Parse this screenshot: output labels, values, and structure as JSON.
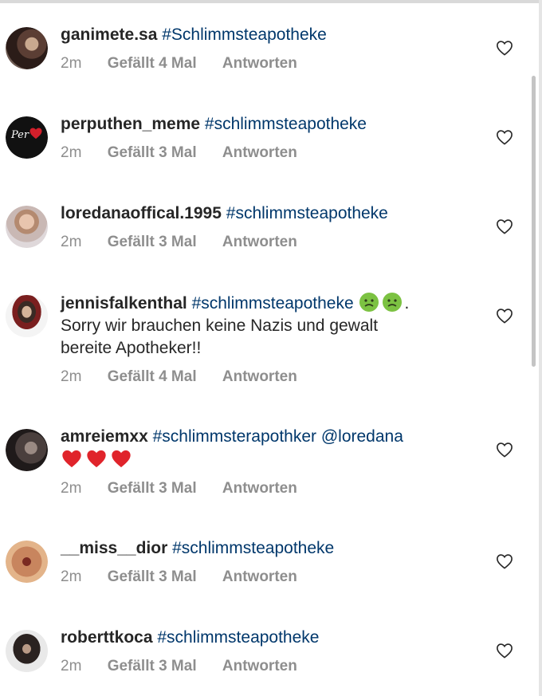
{
  "comments": [
    {
      "username": "ganimete.sa",
      "text": "#Schlimmsteapotheke",
      "time": "2m",
      "likes": "Gefällt 4 Mal",
      "reply": "Antworten"
    },
    {
      "username": "perputhen_meme",
      "text": "#schlimmsteapotheke",
      "time": "2m",
      "likes": "Gefällt 3 Mal",
      "reply": "Antworten",
      "avatar_text": "Per"
    },
    {
      "username": "loredanaoffical.1995",
      "text": "#schlimmsteapotheke",
      "time": "2m",
      "likes": "Gefällt 3 Mal",
      "reply": "Antworten"
    },
    {
      "username": "jennisfalkenthal",
      "text": "#schlimmsteapotheke",
      "text_after": ".",
      "text_line2": "Sorry wir brauchen keine Nazis und gewalt",
      "text_line3": "bereite Apotheker!!",
      "time": "2m",
      "likes": "Gefällt 4 Mal",
      "reply": "Antworten"
    },
    {
      "username": "amreiemxx",
      "text": "#schlimmsterapothker",
      "mention": "@loredana",
      "time": "2m",
      "likes": "Gefällt 3 Mal",
      "reply": "Antworten"
    },
    {
      "username": "__miss__dior",
      "text": "#schlimmsteapotheke",
      "time": "2m",
      "likes": "Gefällt 3 Mal",
      "reply": "Antworten"
    },
    {
      "username": "roberttkoca",
      "text": "#schlimmsteapotheke",
      "time": "2m",
      "likes": "Gefällt 3 Mal",
      "reply": "Antworten"
    }
  ],
  "icons": {
    "like": "heart-outline-icon",
    "emoji_sick": "nauseated-face-emoji",
    "emoji_heart": "red-heart-emoji"
  },
  "colors": {
    "hashtag": "#00376b",
    "meta": "#8e8e8e",
    "text": "#262626",
    "heart_emoji": "#e0242b",
    "sick_emoji": "#7cc242"
  }
}
